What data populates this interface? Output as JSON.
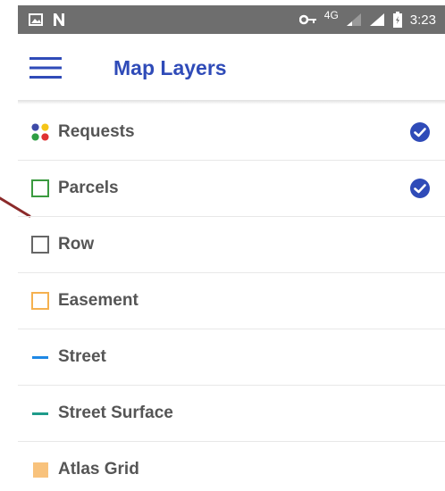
{
  "status_bar": {
    "network": "4G",
    "time": "3:23"
  },
  "app_bar": {
    "title": "Map Layers",
    "menu_icon": "hamburger-menu-icon"
  },
  "layers": [
    {
      "label": "Requests",
      "icon": "multicolor-dots-icon",
      "checked": true
    },
    {
      "label": "Parcels",
      "icon": "outlined-square-icon",
      "color": "#3a9a3f",
      "checked": true
    },
    {
      "label": "Row",
      "icon": "outlined-square-icon",
      "color": "#666666",
      "checked": false
    },
    {
      "label": "Easement",
      "icon": "outlined-square-icon",
      "color": "#f5b14f",
      "checked": false
    },
    {
      "label": "Street",
      "icon": "line-icon",
      "color": "#1e88e5",
      "checked": false
    },
    {
      "label": "Street Surface",
      "icon": "line-icon",
      "color": "#1e9b8a",
      "checked": false
    },
    {
      "label": "Atlas Grid",
      "icon": "filled-square-icon",
      "color": "#f8c27c",
      "checked": false
    }
  ],
  "colors": {
    "accent": "#2f4bb8",
    "check": "#2f4bb8",
    "status_bar": "#6e6e6e",
    "annotation_arrow": "#8b2a2a"
  }
}
